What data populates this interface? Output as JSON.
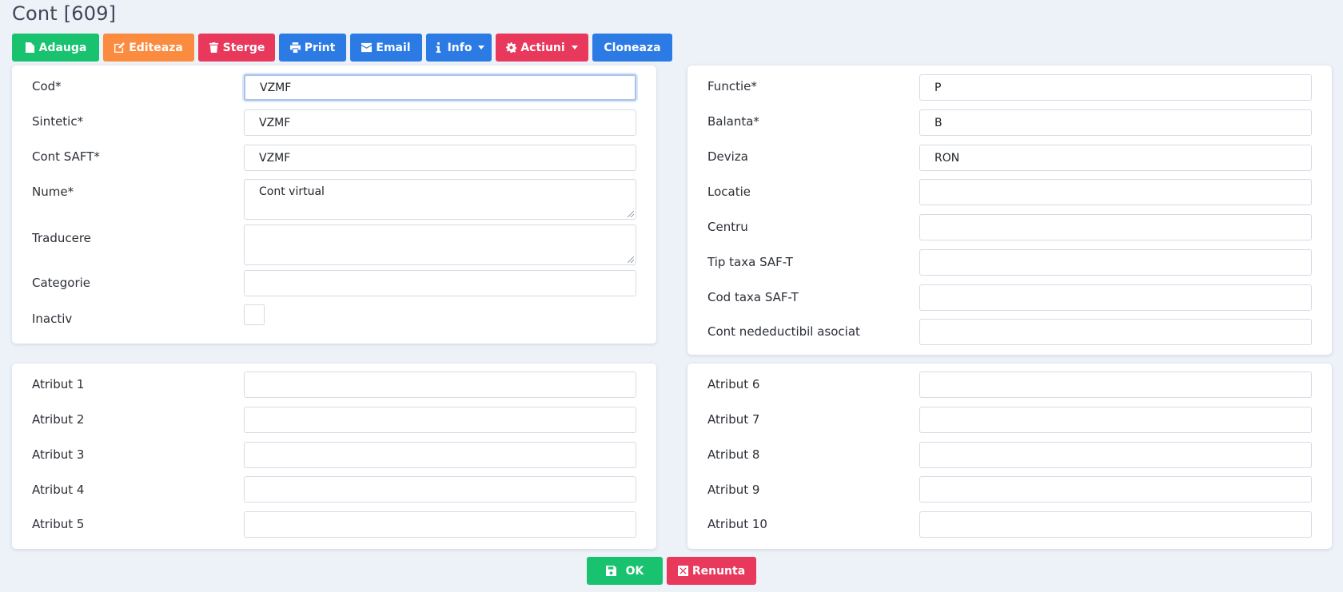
{
  "title": "Cont [609]",
  "toolbar": {
    "add": "Adauga",
    "edit": "Editeaza",
    "delete": "Sterge",
    "print": "Print",
    "email": "Email",
    "info": "Info",
    "actions": "Actiuni",
    "clone": "Cloneaza"
  },
  "left_main": {
    "cod": {
      "label": "Cod*",
      "value": "VZMF"
    },
    "sintetic": {
      "label": "Sintetic*",
      "value": "VZMF"
    },
    "cont_saft": {
      "label": "Cont SAFT*",
      "value": "VZMF"
    },
    "nume": {
      "label": "Nume*",
      "value": "Cont virtual"
    },
    "traducere": {
      "label": "Traducere",
      "value": ""
    },
    "categorie": {
      "label": "Categorie",
      "value": ""
    },
    "inactiv": {
      "label": "Inactiv",
      "checked": false
    }
  },
  "right_main": {
    "functie": {
      "label": "Functie*",
      "value": "P"
    },
    "balanta": {
      "label": "Balanta*",
      "value": "B"
    },
    "deviza": {
      "label": "Deviza",
      "value": "RON"
    },
    "locatie": {
      "label": "Locatie",
      "value": ""
    },
    "centru": {
      "label": "Centru",
      "value": ""
    },
    "tip_taxa": {
      "label": "Tip taxa SAF-T",
      "value": ""
    },
    "cod_taxa": {
      "label": "Cod taxa SAF-T",
      "value": ""
    },
    "cont_nedeductibil": {
      "label": "Cont nedeductibil asociat",
      "value": ""
    }
  },
  "attributes_left": [
    {
      "label": "Atribut 1",
      "value": ""
    },
    {
      "label": "Atribut 2",
      "value": ""
    },
    {
      "label": "Atribut 3",
      "value": ""
    },
    {
      "label": "Atribut 4",
      "value": ""
    },
    {
      "label": "Atribut 5",
      "value": ""
    }
  ],
  "attributes_right": [
    {
      "label": "Atribut 6",
      "value": ""
    },
    {
      "label": "Atribut 7",
      "value": ""
    },
    {
      "label": "Atribut 8",
      "value": ""
    },
    {
      "label": "Atribut 9",
      "value": ""
    },
    {
      "label": "Atribut 10",
      "value": ""
    }
  ],
  "footer": {
    "ok": "OK",
    "cancel": "Renunta"
  },
  "colors": {
    "green": "#18c26f",
    "orange": "#fb8b3e",
    "red": "#e8385b",
    "blue": "#2c7be5"
  }
}
